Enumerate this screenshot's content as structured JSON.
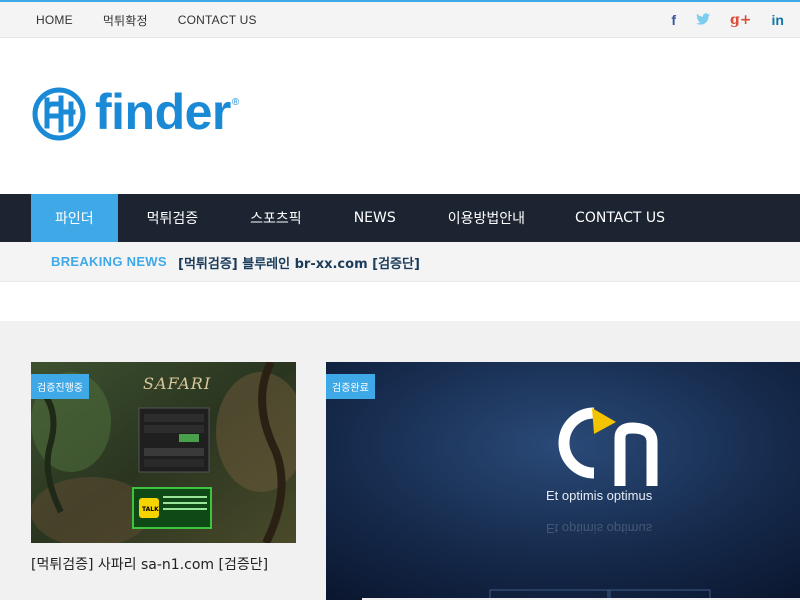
{
  "topbar": {
    "links": [
      "HOME",
      "먹튀확정",
      "CONTACT US"
    ],
    "social": [
      {
        "icon": "facebook-icon",
        "glyph": "f",
        "color": "#3b5998"
      },
      {
        "icon": "twitter-icon",
        "glyph": "🐦",
        "color": "#5bc0de"
      },
      {
        "icon": "google-plus-icon",
        "glyph": "g+",
        "color": "#dd4b39"
      },
      {
        "icon": "linkedin-icon",
        "glyph": "in",
        "color": "#0e76a8"
      }
    ]
  },
  "logo": {
    "word": "finder",
    "mark": "®",
    "color": "#1a8ad6"
  },
  "mainnav": {
    "items": [
      "파인더",
      "먹튀검증",
      "스포츠픽",
      "NEWS",
      "이용방법안내",
      "CONTACT US"
    ],
    "active_index": 0
  },
  "breaking": {
    "label": "BREAKING NEWS",
    "headline": "[먹튀검증] 블루레인 br-xx.com [검증단]"
  },
  "cards": {
    "card1": {
      "badge": "검증진행중",
      "image_brand": "SAFARI",
      "title": "[먹튀검증] 사파리 sa-n1.com [검증단]"
    },
    "card2": {
      "badge": "검증완료",
      "logo_text": "On",
      "tagline": "Et optimis optimus"
    }
  },
  "colors": {
    "accent": "#3fa9e8",
    "nav_bg": "#1b2430",
    "content_bg": "#f1f1f1"
  }
}
